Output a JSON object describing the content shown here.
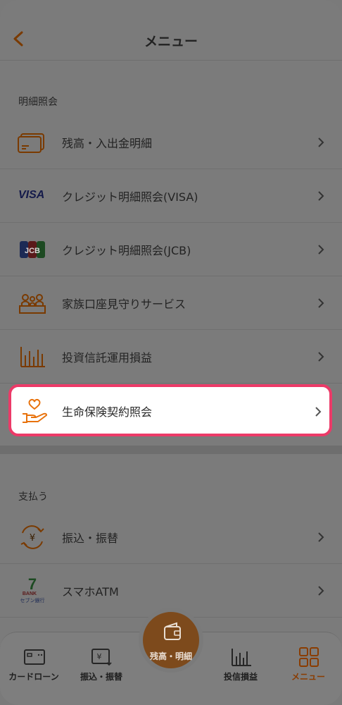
{
  "header": {
    "title": "メニュー"
  },
  "sections": [
    {
      "label": "明細照会",
      "items": [
        {
          "label": "残高・入出金明細",
          "icon": "card-icon"
        },
        {
          "label": "クレジット明細照会(VISA)",
          "icon": "visa-logo-icon"
        },
        {
          "label": "クレジット明細照会(JCB)",
          "icon": "jcb-logo-icon"
        },
        {
          "label": "家族口座見守りサービス",
          "icon": "family-icon"
        },
        {
          "label": "投資信託運用損益",
          "icon": "chart-icon"
        },
        {
          "label": "生命保険契約照会",
          "icon": "hand-heart-icon"
        }
      ]
    },
    {
      "label": "支払う",
      "items": [
        {
          "label": "振込・振替",
          "icon": "yen-transfer-icon"
        },
        {
          "label": "スマホATM",
          "icon": "seven-bank-icon"
        }
      ]
    }
  ],
  "logos": {
    "visa": "VISA",
    "jcb": "JCB",
    "seven_bank": "BANK",
    "seven_bank_sub": "セブン銀行"
  },
  "tabbar": {
    "items": [
      {
        "label": "カードローン",
        "icon": "card-loan-icon"
      },
      {
        "label": "振込・振替",
        "icon": "transfer-icon"
      },
      {
        "label": "残高・明細",
        "icon": "wallet-icon"
      },
      {
        "label": "投信損益",
        "icon": "chart-icon"
      },
      {
        "label": "メニュー",
        "icon": "grid-icon"
      }
    ]
  },
  "colors": {
    "accent": "#e8720c",
    "highlight_border": "#ec3a68",
    "visa_blue": "#1a1f71",
    "overlay": "#7b7b7b"
  }
}
